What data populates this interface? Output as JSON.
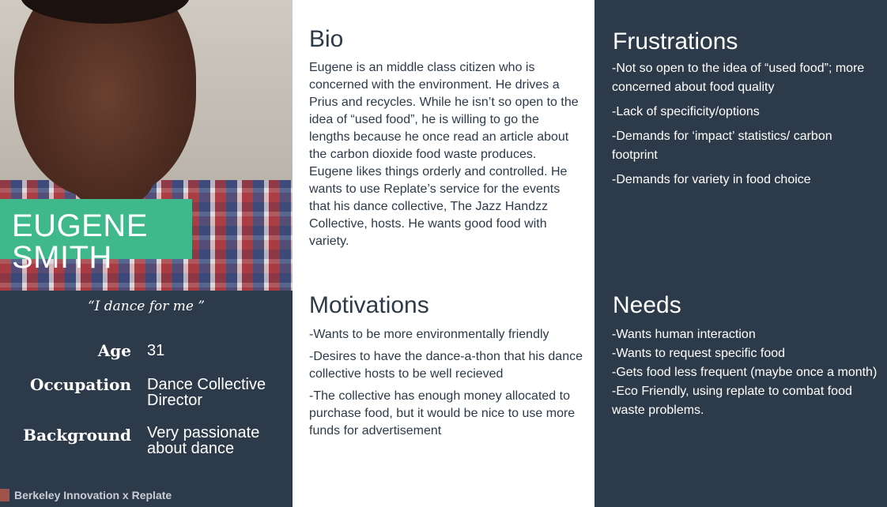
{
  "persona": {
    "first_name": "EUGENE",
    "last_name": "SMITH",
    "quote": "“I dance for me ”",
    "details": [
      {
        "label": "Age",
        "value": "31"
      },
      {
        "label": "Occupation",
        "value": "Dance Collective Director"
      },
      {
        "label": "Background",
        "value": "Very passionate about dance"
      }
    ]
  },
  "footer": {
    "text": "Berkeley Innovation x Replate"
  },
  "bio": {
    "heading": "Bio",
    "text": "Eugene is an middle class citizen who is concerned with the environment. He drives a Prius and recycles. While he isn’t so open to the idea of “used food”, he is willing to go the lengths because he once read an article about the carbon dioxide food waste produces. Eugene likes things orderly and controlled. He wants to use Replate’s service for the events that his dance collective, The Jazz Handzz Collective, hosts. He wants good food with variety."
  },
  "motivations": {
    "heading": "Motivations",
    "items": [
      "-Wants to be more environmentally friendly",
      "-Desires to have the dance-a-thon that his dance collective hosts to be well recieved",
      "-The collective has enough money allocated to purchase food, but it would be nice to use more funds for advertisement"
    ]
  },
  "frustrations": {
    "heading": "Frustrations",
    "items": [
      "-Not so open to the idea of “used food”; more concerned about food quality",
      "-Lack of specificity/options",
      "-Demands for ‘impact’ statistics/ carbon footprint",
      "-Demands for variety in food choice"
    ]
  },
  "needs": {
    "heading": "Needs",
    "items": [
      "-Wants human interaction",
      "-Wants to request specific food",
      "-Gets food less frequent (maybe once a month)",
      "-Eco Friendly, using replate to combat food waste problems."
    ]
  },
  "colors": {
    "dark": "#2d3a49",
    "accent": "#3fb98b",
    "white": "#ffffff"
  }
}
